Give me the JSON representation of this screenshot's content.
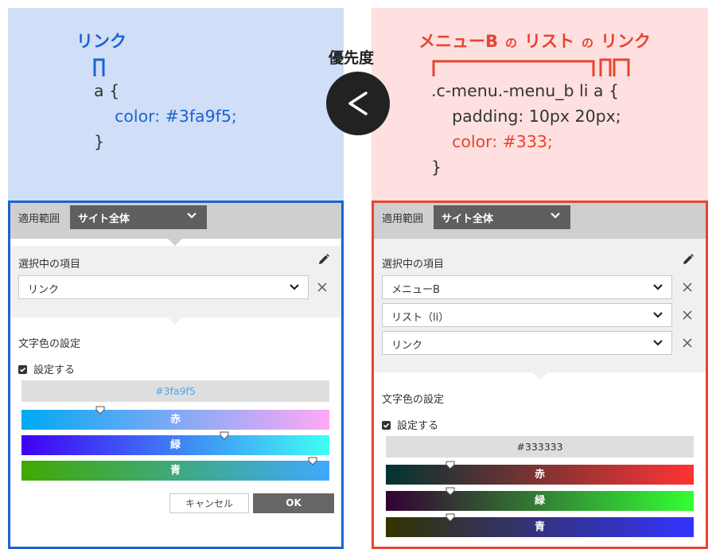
{
  "colors": {
    "left_accent": "#1d62d3",
    "right_accent": "#e8442f",
    "left_code_bg": "#d0dff7",
    "right_code_bg": "#fde0df",
    "dark": "#222222"
  },
  "header": {
    "priority_label": "優先度",
    "comparison_symbol": "<"
  },
  "left": {
    "selector_label": "リンク",
    "code_lines": [
      "a {",
      "color: #3fa9f5;",
      "}"
    ],
    "panel": {
      "scope_label": "適用範囲",
      "scope_value": "サイト全体",
      "selected_items_title": "選択中の項目",
      "items": [
        "リンク"
      ],
      "text_color_title": "文字色の設定",
      "checkbox_label": "設定する",
      "hex_value": "#3fa9f5",
      "sliders": [
        {
          "label": "赤",
          "value": 63
        },
        {
          "label": "緑",
          "value": 169
        },
        {
          "label": "青",
          "value": 245
        }
      ],
      "cancel_label": "キャンセル",
      "ok_label": "OK"
    }
  },
  "right": {
    "selector_label": {
      "part1": "メニューB",
      "sep1": "の",
      "part2": "リスト",
      "sep2": "の",
      "part3": "リンク"
    },
    "code_lines": [
      ".c-menu.-menu_b li a {",
      "padding: 10px 20px;",
      "color: #333;",
      "}"
    ],
    "panel": {
      "scope_label": "適用範囲",
      "scope_value": "サイト全体",
      "selected_items_title": "選択中の項目",
      "items": [
        "メニューB",
        "リスト（li）",
        "リンク"
      ],
      "text_color_title": "文字色の設定",
      "checkbox_label": "設定する",
      "hex_value": "#333333",
      "sliders": [
        {
          "label": "赤",
          "value": 51
        },
        {
          "label": "緑",
          "value": 51
        },
        {
          "label": "青",
          "value": 51
        }
      ]
    }
  },
  "icons": [
    "chevron-down-icon",
    "pencil-icon",
    "close-icon",
    "checkbox-checked-icon",
    "slider-thumb-icon"
  ]
}
